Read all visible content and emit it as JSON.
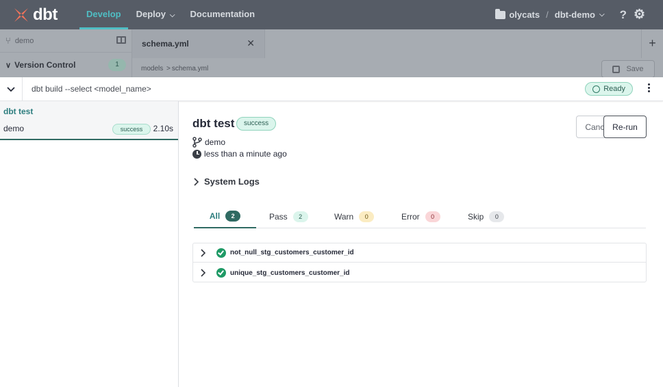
{
  "topnav": {
    "brand": "dbt",
    "items": [
      {
        "label": "Develop",
        "active": true
      },
      {
        "label": "Deploy",
        "has_menu": true
      },
      {
        "label": "Documentation"
      }
    ],
    "org": "olycats",
    "project": "dbt-demo",
    "icons": {
      "folder": "folder-icon",
      "help": "help-icon",
      "settings": "gear-icon"
    }
  },
  "ide": {
    "branch": "demo",
    "version_control": {
      "label": "Version Control",
      "count": "1"
    },
    "open_tab": "schema.yml",
    "breadcrumb": [
      "models",
      "schema.yml"
    ],
    "breadcrumb_sep": ">",
    "save_label": "Save"
  },
  "command_bar": {
    "command": "dbt build --select <model_name>",
    "status": "Ready"
  },
  "runs": [
    {
      "title": "dbt test",
      "branch": "demo",
      "status": "success",
      "duration": "2.10s"
    }
  ],
  "detail": {
    "title": "dbt test",
    "status": "success",
    "branch": "demo",
    "time": "less than a minute ago",
    "cancel_label": "Cancel",
    "rerun_label": "Re-run",
    "system_logs": "System Logs",
    "tabs": [
      {
        "label": "All",
        "count": "2"
      },
      {
        "label": "Pass",
        "count": "2"
      },
      {
        "label": "Warn",
        "count": "0"
      },
      {
        "label": "Error",
        "count": "0"
      },
      {
        "label": "Skip",
        "count": "0"
      }
    ],
    "results": [
      {
        "name": "not_null_stg_customers_customer_id",
        "status": "pass"
      },
      {
        "name": "unique_stg_customers_customer_id",
        "status": "pass"
      }
    ]
  },
  "colors": {
    "nav_bg": "#565c66",
    "accent": "#2f6a62",
    "active_nav": "#4fbec4",
    "success_bg": "#dbf5ec",
    "pass_icon": "#1f9a66"
  }
}
